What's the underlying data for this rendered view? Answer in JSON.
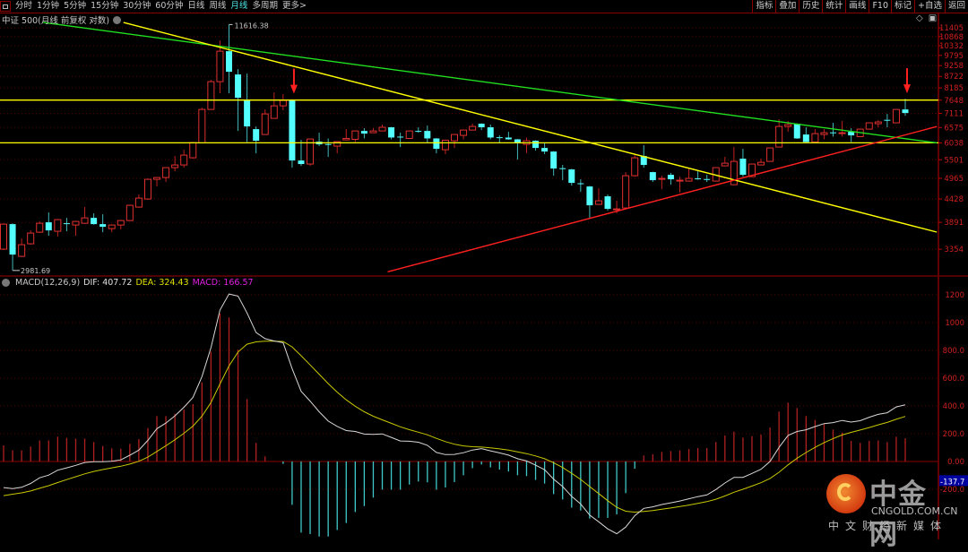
{
  "toolbar": {
    "periods": [
      "分时",
      "1分钟",
      "5分钟",
      "15分钟",
      "30分钟",
      "60分钟",
      "日线",
      "周线",
      "月线",
      "多周期",
      "更多>"
    ],
    "active_period": "月线",
    "buttons": [
      "指标",
      "叠加",
      "历史",
      "统计",
      "画线",
      "F10",
      "标记",
      "+自选",
      "返回"
    ]
  },
  "title": "中证 500(月线 前复权 对数)",
  "tool_icons": {
    "diamond": "◇",
    "panel": "▣"
  },
  "colors": {
    "up": "#e03030",
    "down": "#54ffff",
    "dif": "#d8d8d8",
    "dea": "#c8c800",
    "macd": "#d020d0",
    "axis": "#d02020",
    "support": "#ffff00",
    "green_line": "#20e020",
    "red_line": "#ff2020"
  },
  "macd_header": {
    "name": "MACD(12,26,9)",
    "dif": "DIF: 407.72",
    "dea": "DEA: 324.43",
    "macd": "MACD: 166.57"
  },
  "chart_data": [
    {
      "type": "candlestick",
      "title": "中证 500(月线 前复权 对数)",
      "y_scale": "log",
      "y_ticks": [
        "11405",
        "10868",
        "10332",
        "9795",
        "9258",
        "8722",
        "8185",
        "7648",
        "7111",
        "6575",
        "6038",
        "5501",
        "4965",
        "4428",
        "3891",
        "3354"
      ],
      "y_tick_values": [
        11405,
        10868,
        10332,
        9795,
        9258,
        8722,
        8185,
        7648,
        7111,
        6575,
        6038,
        5501,
        4965,
        4428,
        3891,
        3354
      ],
      "high_label": "11616.38",
      "low_label": "2981.69",
      "high_index": 25,
      "low_index": 1,
      "ohlc": [
        [
          3355,
          3870,
          3340,
          3853
        ],
        [
          3853,
          3870,
          2982,
          3256
        ],
        [
          3224,
          3560,
          3210,
          3439
        ],
        [
          3456,
          3722,
          3440,
          3667
        ],
        [
          3685,
          3911,
          3670,
          3872
        ],
        [
          3892,
          4110,
          3613,
          3722
        ],
        [
          3704,
          3965,
          3595,
          3950
        ],
        [
          3872,
          3989,
          3704,
          3853
        ],
        [
          3834,
          3925,
          3613,
          3911
        ],
        [
          3872,
          4234,
          3860,
          3989
        ],
        [
          3989,
          4089,
          3840,
          3853
        ],
        [
          3853,
          4069,
          3685,
          3796
        ],
        [
          3759,
          3850,
          3685,
          3834
        ],
        [
          3834,
          3945,
          3740,
          3930
        ],
        [
          3930,
          4290,
          3920,
          4276
        ],
        [
          4234,
          4538,
          4220,
          4449
        ],
        [
          4427,
          4955,
          4410,
          4937
        ],
        [
          4937,
          5000,
          4745,
          4986
        ],
        [
          4986,
          5280,
          4864,
          5266
        ],
        [
          5266,
          5616,
          5162,
          5345
        ],
        [
          5345,
          5814,
          5266,
          5644
        ],
        [
          5561,
          6065,
          5533,
          6049
        ],
        [
          6038,
          7338,
          6020,
          7265
        ],
        [
          7265,
          8556,
          7250,
          8472
        ],
        [
          8472,
          10641,
          7944,
          10027
        ],
        [
          10027,
          11617,
          7944,
          8947
        ],
        [
          8815,
          9080,
          6451,
          7750
        ],
        [
          7635,
          8858,
          6068,
          6613
        ],
        [
          6516,
          6613,
          5700,
          6110
        ],
        [
          6325,
          7265,
          6310,
          7088
        ],
        [
          6915,
          7983,
          6900,
          7411
        ],
        [
          7411,
          7905,
          7229,
          7635
        ],
        [
          7673,
          7690,
          5266,
          5478
        ],
        [
          5478,
          6140,
          5318,
          5372
        ],
        [
          5372,
          6185,
          5318,
          6170
        ],
        [
          6080,
          6388,
          5931,
          5990
        ],
        [
          6000,
          6189,
          5588,
          5990
        ],
        [
          5931,
          6095,
          5700,
          6080
        ],
        [
          6140,
          6516,
          6125,
          6189
        ],
        [
          6158,
          6465,
          6068,
          6451
        ],
        [
          6451,
          6549,
          6189,
          6356
        ],
        [
          6388,
          6549,
          6375,
          6451
        ],
        [
          6451,
          6680,
          6440,
          6582
        ],
        [
          6582,
          6595,
          6158,
          6220
        ],
        [
          6251,
          6388,
          5901,
          6220
        ],
        [
          6189,
          6465,
          6175,
          6451
        ],
        [
          6451,
          6582,
          6388,
          6420
        ],
        [
          6451,
          6646,
          6038,
          6189
        ],
        [
          6189,
          6200,
          5700,
          5843
        ],
        [
          5814,
          6145,
          5672,
          6130
        ],
        [
          6110,
          6340,
          5872,
          6325
        ],
        [
          6294,
          6498,
          6158,
          6483
        ],
        [
          6483,
          6714,
          6470,
          6613
        ],
        [
          6714,
          6730,
          6483,
          6582
        ],
        [
          6582,
          6680,
          6158,
          6220
        ],
        [
          6230,
          6294,
          6038,
          6220
        ],
        [
          6220,
          6420,
          6145,
          6158
        ],
        [
          6158,
          6170,
          5506,
          6038
        ],
        [
          5990,
          6220,
          5700,
          6110
        ],
        [
          6110,
          6125,
          5785,
          5872
        ],
        [
          5872,
          6038,
          5672,
          5756
        ],
        [
          5756,
          5770,
          5036,
          5240
        ],
        [
          5250,
          5345,
          4913,
          5240
        ],
        [
          5214,
          5230,
          4769,
          4840
        ],
        [
          4830,
          4937,
          4606,
          4816
        ],
        [
          4745,
          4760,
          3989,
          4276
        ],
        [
          4298,
          4698,
          4285,
          4384
        ],
        [
          4494,
          4538,
          4151,
          4192
        ],
        [
          4172,
          4384,
          4089,
          4192
        ],
        [
          4213,
          5137,
          4200,
          5036
        ],
        [
          5036,
          5644,
          5011,
          5561
        ],
        [
          5616,
          5961,
          5266,
          5345
        ],
        [
          5137,
          5150,
          4864,
          4913
        ],
        [
          4937,
          5036,
          4675,
          4962
        ],
        [
          5061,
          5112,
          4792,
          4937
        ],
        [
          4905,
          5011,
          4583,
          4913
        ],
        [
          4889,
          5240,
          4875,
          4962
        ],
        [
          4962,
          5162,
          4925,
          4937
        ],
        [
          4945,
          5061,
          4864,
          4937
        ],
        [
          4889,
          5280,
          4875,
          5266
        ],
        [
          5318,
          5588,
          5305,
          5398
        ],
        [
          4792,
          5901,
          4780,
          5451
        ],
        [
          5533,
          5843,
          5011,
          5061
        ],
        [
          5011,
          5385,
          5000,
          5372
        ],
        [
          5345,
          5533,
          5330,
          5424
        ],
        [
          5451,
          5885,
          5440,
          5872
        ],
        [
          5901,
          6881,
          5890,
          6613
        ],
        [
          6613,
          6813,
          6420,
          6680
        ],
        [
          6714,
          6730,
          6175,
          6189
        ],
        [
          6325,
          6582,
          6055,
          6068
        ],
        [
          6068,
          6516,
          6055,
          6356
        ],
        [
          6325,
          6516,
          6158,
          6388
        ],
        [
          6400,
          6747,
          6251,
          6388
        ],
        [
          6356,
          6813,
          6251,
          6388
        ],
        [
          6420,
          6549,
          6068,
          6294
        ],
        [
          6251,
          6530,
          6240,
          6516
        ],
        [
          6516,
          6760,
          6500,
          6747
        ],
        [
          6714,
          6847,
          6582,
          6780
        ],
        [
          6860,
          7088,
          6582,
          6847
        ],
        [
          6747,
          7280,
          6730,
          7265
        ],
        [
          7265,
          7711,
          7019,
          7123
        ]
      ],
      "horizontal_lines": [
        7650,
        6040
      ],
      "trendlines": [
        {
          "name": "green-resistance",
          "color": "#20e020",
          "from": [
            4.4,
            11752
          ],
          "to": [
            103.5,
            6038
          ]
        },
        {
          "name": "yellow-resistance",
          "color": "#ffff00",
          "from": [
            13.3,
            11752
          ],
          "to": [
            103.5,
            3687
          ]
        },
        {
          "name": "red-support",
          "color": "#ff2020",
          "from": [
            42.6,
            2960
          ],
          "to": [
            103.5,
            6610
          ]
        }
      ],
      "arrow_indices": [
        32,
        100
      ]
    },
    {
      "type": "bar+line",
      "title": "MACD(12,26,9)",
      "y_ticks": [
        "1200",
        "1000",
        "800.0",
        "600.0",
        "400.0",
        "200.0",
        "0.00",
        "-200.0"
      ],
      "y_tick_values": [
        1200,
        1000,
        800,
        600,
        400,
        200,
        0,
        -200
      ],
      "current_marker": "-137.7",
      "current_marker_value": -137.7,
      "dif_last": 407.72,
      "dea_last": 324.43,
      "macd_last": 166.57,
      "hist": [
        116,
        80,
        80,
        108,
        151,
        152,
        179,
        170,
        165,
        165,
        140,
        112,
        95,
        92,
        127,
        161,
        241,
        327,
        327,
        344,
        374,
        413,
        570,
        790,
        1065,
        1037,
        805,
        450,
        134,
        37,
        3,
        -17,
        -312,
        -512,
        -522,
        -540,
        -540,
        -493,
        -443,
        -364,
        -321,
        -260,
        -203,
        -203,
        -203,
        -166,
        -144,
        -150,
        -203,
        -187,
        -148,
        -99,
        -48,
        -22,
        -43,
        -58,
        -72,
        -99,
        -105,
        -133,
        -159,
        -235,
        -273,
        -332,
        -353,
        -411,
        -406,
        -406,
        -381,
        -228,
        -52,
        43,
        52,
        69,
        75,
        80,
        90,
        97,
        97,
        140,
        187,
        215,
        172,
        183,
        194,
        245,
        359,
        424,
        385,
        327,
        299,
        273,
        230,
        209,
        148,
        134,
        148,
        151,
        140,
        179,
        167
      ]
    }
  ],
  "logo": {
    "cn": "中金网",
    "en": "CNGOLD.COM.CN",
    "slogan": "中文财经新媒体"
  }
}
